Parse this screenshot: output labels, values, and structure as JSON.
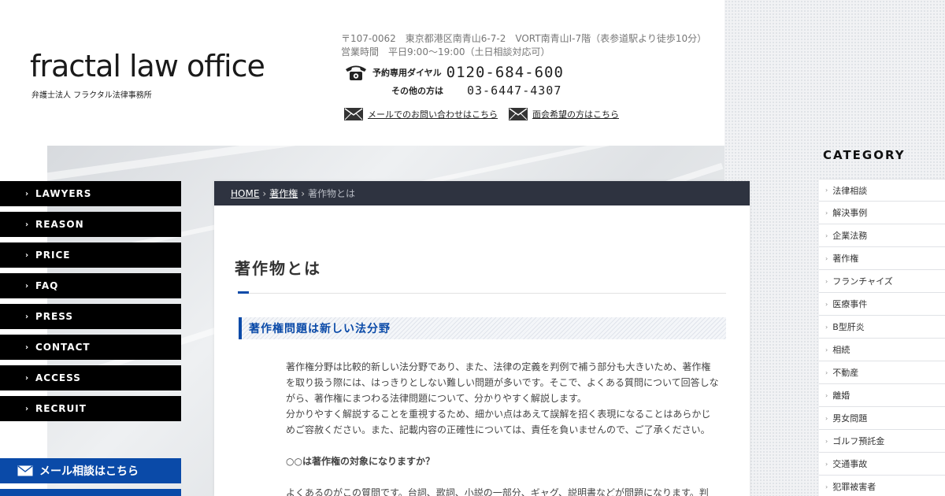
{
  "header": {
    "logo_main": "fractal law office",
    "logo_sub": "弁護士法人 フラクタル法律事務所",
    "address_line1": "〒107-0062　東京都港区南青山6-7-2　VORT南青山Ⅰ-7階（表参道駅より徒歩10分）",
    "address_line2": "営業時間　平日9:00～19:00（土日相談対応可）",
    "phone1_label": "予約専用ダイヤル",
    "phone1_number": "0120-684-600",
    "phone2_label": "その他の方は",
    "phone2_number": "03-6447-4307",
    "mail_link": "メールでのお問い合わせはこちら",
    "meeting_link": "面会希望の方はこちら"
  },
  "nav": {
    "items": [
      {
        "label": "LAWYERS"
      },
      {
        "label": "REASON"
      },
      {
        "label": "PRICE"
      },
      {
        "label": "FAQ"
      },
      {
        "label": "PRESS"
      },
      {
        "label": "CONTACT"
      },
      {
        "label": "ACCESS"
      },
      {
        "label": "RECRUIT"
      }
    ],
    "mail_cta": "メール相談はこちら"
  },
  "breadcrumb": {
    "home": "HOME",
    "parent": "著作権",
    "current": "著作物とは"
  },
  "main": {
    "title": "著作物とは",
    "section_heading": "著作権問題は新しい法分野",
    "paragraph1": "著作権分野は比較的新しい法分野であり、また、法律の定義を判例で補う部分も大きいため、著作権を取り扱う際には、はっきりとしない難しい問題が多いです。そこで、よくある質問について回答しながら、著作権にまつわる法律問題について、分かりやすく解説します。",
    "paragraph2": "分かりやすく解説することを重視するため、細かい点はあえて誤解を招く表現になることはあらかじめご容赦ください。また、記載内容の正確性については、責任を負いませんので、ご了承ください。",
    "question": "○○は著作権の対象になりますか？",
    "answer": "よくあるのがこの質問です。台詞、歌詞、小説の一部分、ギャグ、説明書などが問題になります。判"
  },
  "sidebar": {
    "category_title": "CATEGORY",
    "items": [
      {
        "label": "法律相談"
      },
      {
        "label": "解決事例"
      },
      {
        "label": "企業法務"
      },
      {
        "label": "著作権"
      },
      {
        "label": "フランチャイズ"
      },
      {
        "label": "医療事件"
      },
      {
        "label": "B型肝炎"
      },
      {
        "label": "相続"
      },
      {
        "label": "不動産"
      },
      {
        "label": "離婚"
      },
      {
        "label": "男女問題"
      },
      {
        "label": "ゴルフ預託金"
      },
      {
        "label": "交通事故"
      },
      {
        "label": "犯罪被害者"
      }
    ]
  },
  "colors": {
    "accent_blue": "#0a4aa8",
    "breadcrumb_bg": "#2e3340",
    "nav_bg": "#000000"
  }
}
